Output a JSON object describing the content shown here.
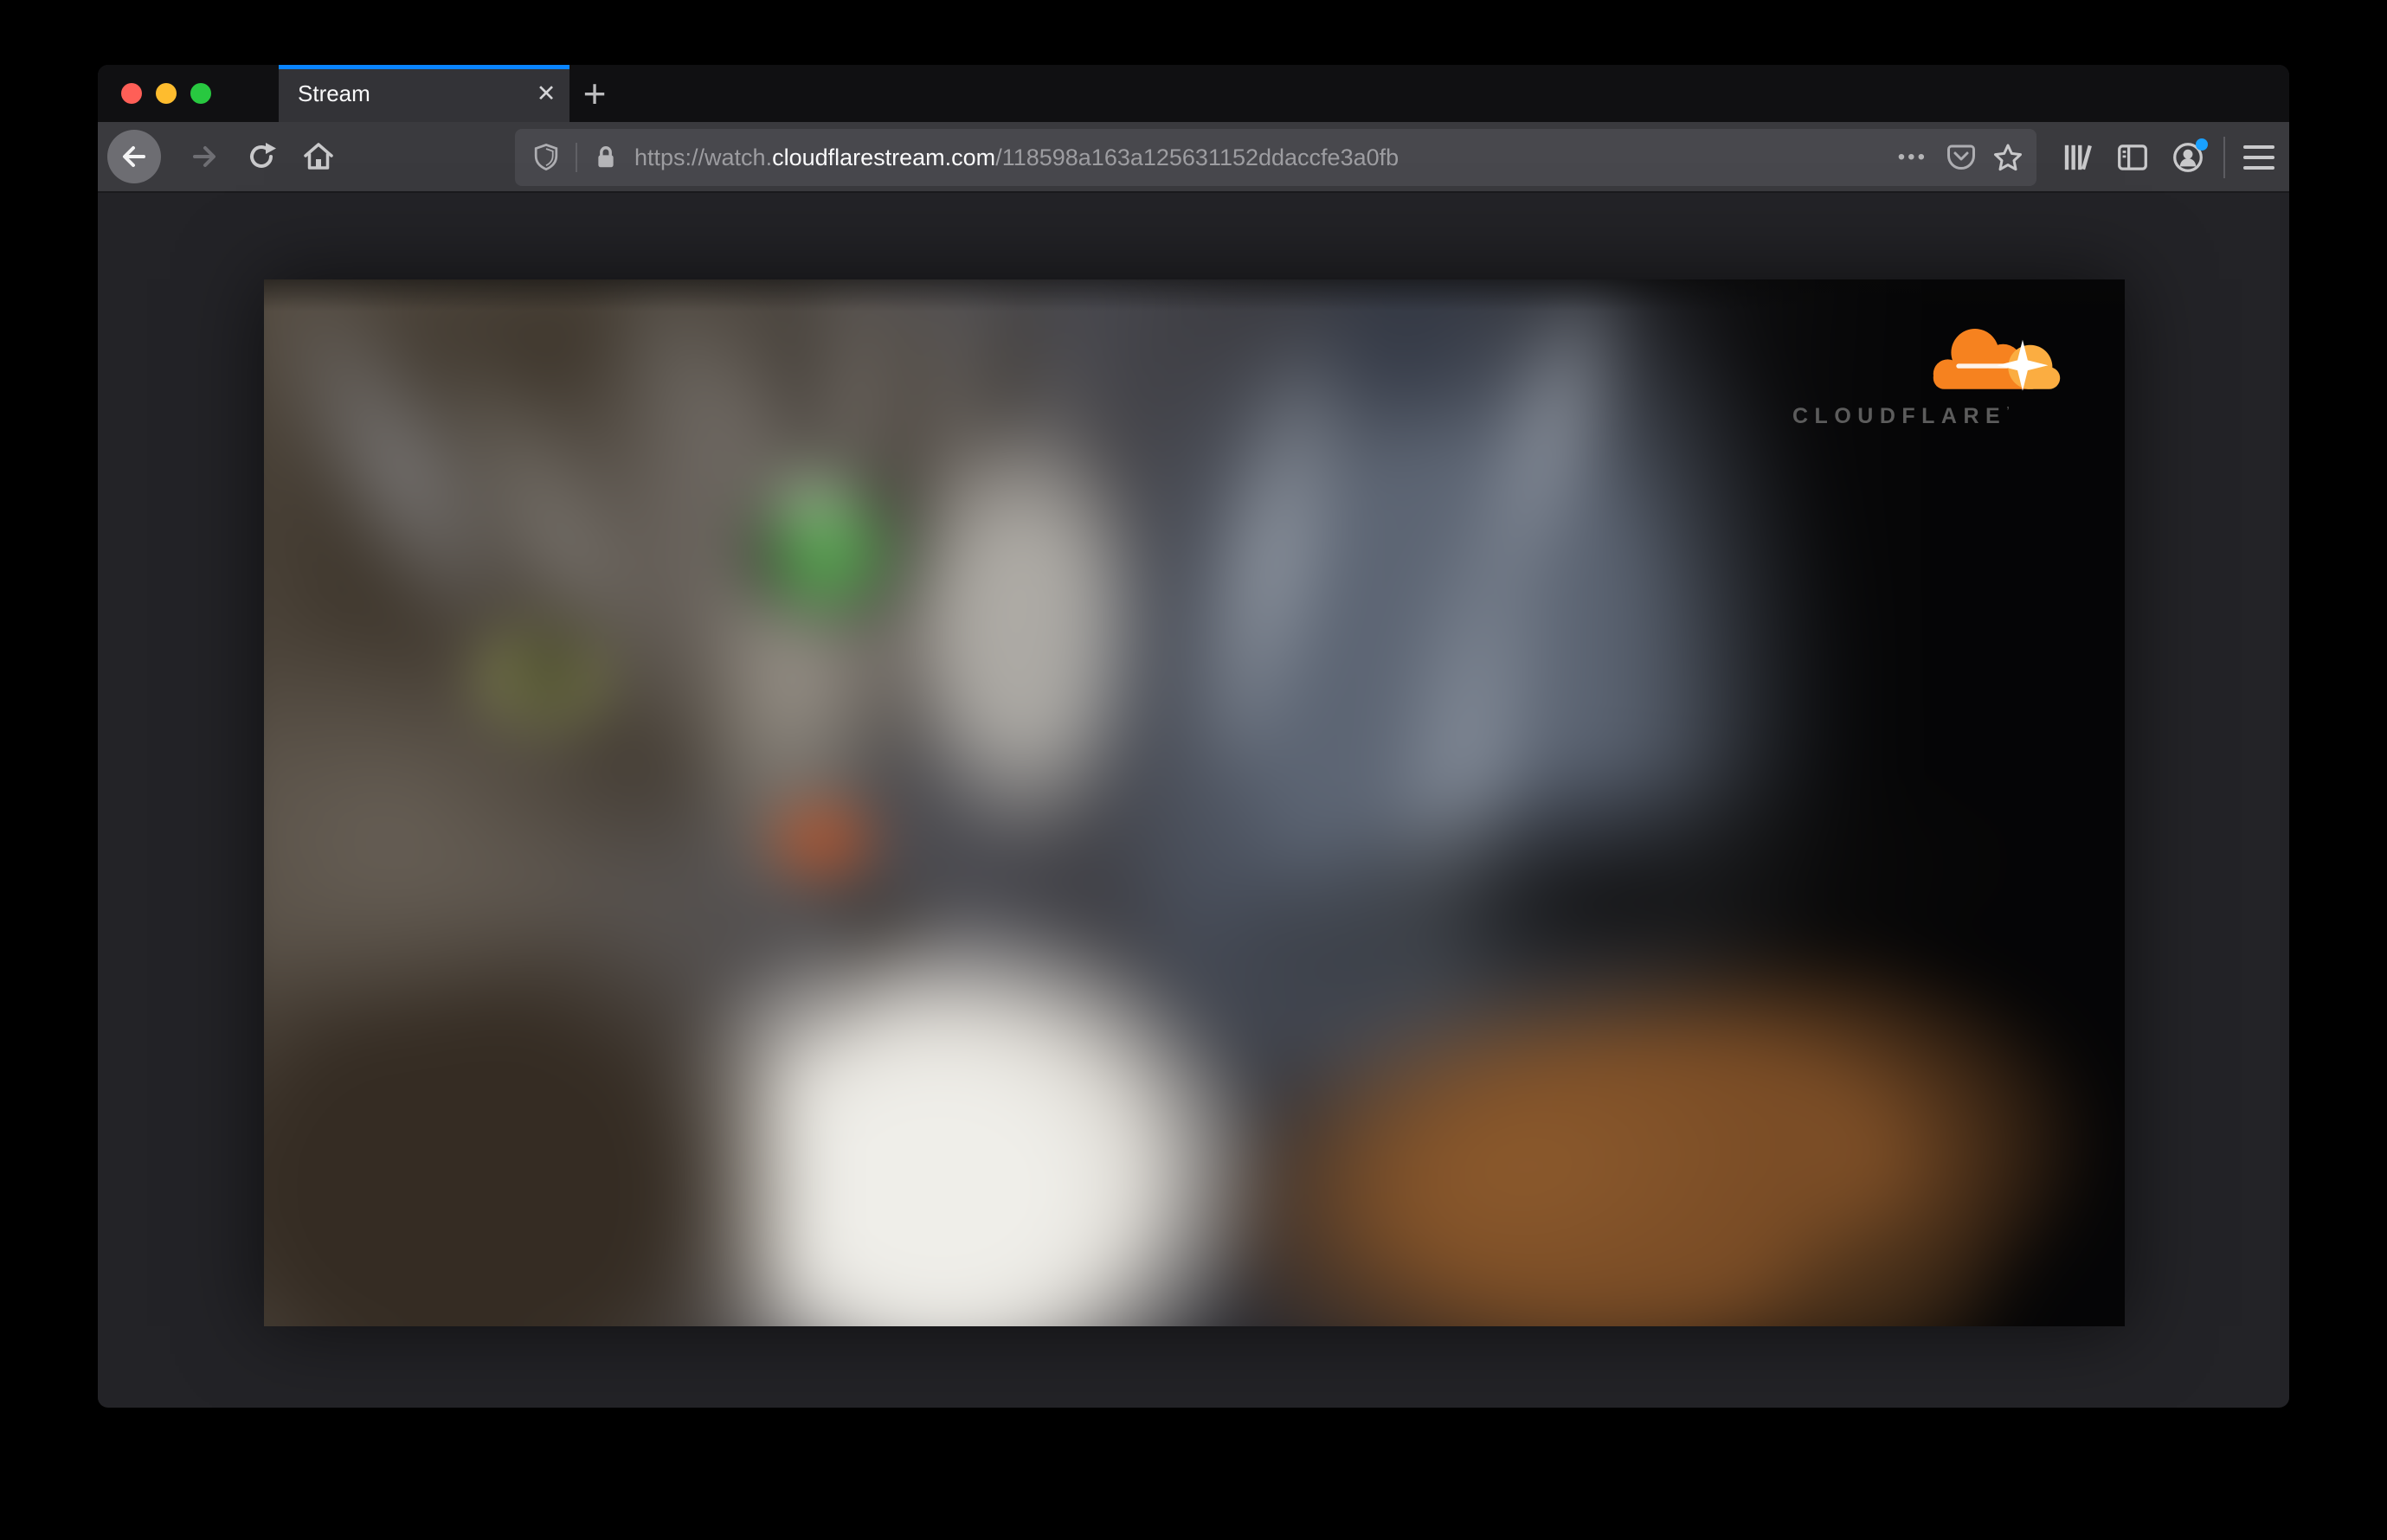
{
  "browser": {
    "traffic_lights": {
      "close_color": "#ff5f57",
      "minimize_color": "#febc2e",
      "zoom_color": "#28c840"
    },
    "tab": {
      "title": "Stream",
      "close_icon": "✕",
      "active_indicator_color": "#0a84ff"
    },
    "new_tab_icon": "+",
    "toolbar": {
      "icons": [
        "back-arrow",
        "forward-arrow",
        "reload",
        "home",
        "library",
        "sidebar",
        "account",
        "menu"
      ],
      "account_badge_color": "#19a1ff"
    },
    "url_bar": {
      "scheme_subdomain": "https://watch.",
      "domain": "cloudflarestream.com",
      "path": "/118598a163a125631152ddaccfe3a0fb",
      "full_url": "https://watch.cloudflarestream.com/118598a163a125631152ddaccfe3a0fb",
      "page_actions_icon": "•••",
      "left_icons": [
        "tracking-protection-shield",
        "lock"
      ],
      "right_icons": [
        "page-actions",
        "pocket",
        "bookmark-star"
      ]
    }
  },
  "video_player": {
    "description": "blurred close-up of a tabby cat with green eyes, white chest, warm brown body, blue-gray background",
    "brand": {
      "name": "CLOUDFLARE",
      "trademark": "’",
      "cloud_orange": "#f6821f",
      "cloud_light_orange": "#fbad41",
      "text_color": "#5c5c5c"
    }
  }
}
